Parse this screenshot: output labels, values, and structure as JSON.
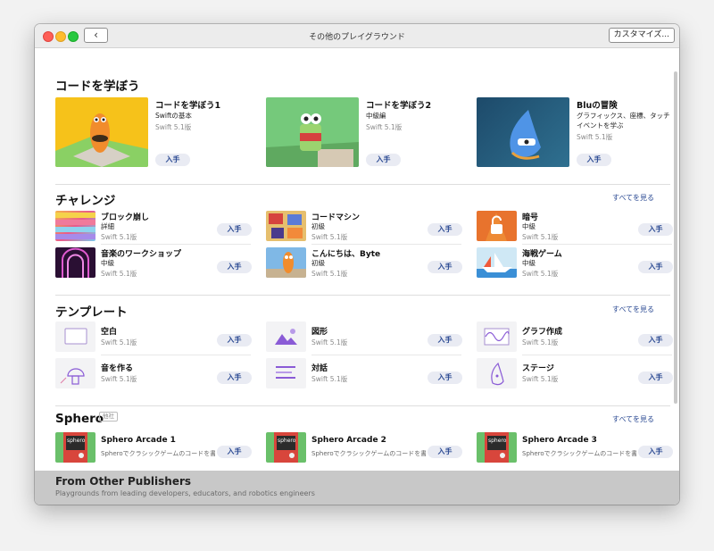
{
  "window": {
    "title": "その他のプレイグラウンド",
    "back_label": "‹",
    "customize_label": "カスタマイズ..."
  },
  "sections": {
    "learn": {
      "title": "コードを学ぼう",
      "items": [
        {
          "title": "コードを学ぼう1",
          "subtitle": "Swiftの基本",
          "version": "Swift 5.1版",
          "button": "入手"
        },
        {
          "title": "コードを学ぼう2",
          "subtitle": "中級編",
          "version": "Swift 5.1版",
          "button": "入手"
        },
        {
          "title": "Bluの冒険",
          "subtitle": "グラフィックス、座標、タッチ",
          "subtitle2": "イベントを学ぶ",
          "version": "Swift 5.1版",
          "button": "入手"
        }
      ]
    },
    "challenge": {
      "title": "チャレンジ",
      "see_all": "すべてを見る",
      "items": [
        {
          "title": "ブロック崩し",
          "level": "詳細",
          "version": "Swift 5.1版",
          "button": "入手"
        },
        {
          "title": "コードマシン",
          "level": "初級",
          "version": "Swift 5.1版",
          "button": "入手"
        },
        {
          "title": "暗号",
          "level": "中級",
          "version": "Swift 5.1版",
          "button": "入手"
        },
        {
          "title": "音楽のワークショップ",
          "level": "中級",
          "version": "Swift 5.1版",
          "button": "入手"
        },
        {
          "title": "こんにちは、Byte",
          "level": "初級",
          "version": "Swift 5.1版",
          "button": "入手"
        },
        {
          "title": "海戦ゲーム",
          "level": "中級",
          "version": "Swift 5.1版",
          "button": "入手"
        }
      ]
    },
    "template": {
      "title": "テンプレート",
      "see_all": "すべてを見る",
      "items": [
        {
          "title": "空白",
          "version": "Swift 5.1版",
          "button": "入手"
        },
        {
          "title": "図形",
          "version": "Swift 5.1版",
          "button": "入手"
        },
        {
          "title": "グラフ作成",
          "version": "Swift 5.1版",
          "button": "入手"
        },
        {
          "title": "音を作る",
          "version": "Swift 5.1版",
          "button": "入手"
        },
        {
          "title": "対話",
          "version": "Swift 5.1版",
          "button": "入手"
        },
        {
          "title": "ステージ",
          "version": "Swift 5.1版",
          "button": "入手"
        }
      ]
    },
    "sphero": {
      "title": "Sphero",
      "badge": "他社",
      "see_all": "すべてを見る",
      "items": [
        {
          "title": "Sphero Arcade 1",
          "desc": "Spheroでクラシックゲームのコードを書…",
          "button": "入手",
          "logo": "sphero"
        },
        {
          "title": "Sphero Arcade 2",
          "desc": "Spheroでクラシックゲームのコードを書…",
          "button": "入手",
          "logo": "sphero"
        },
        {
          "title": "Sphero Arcade 3",
          "desc": "Spheroでクラシックゲームのコードを書…",
          "button": "入手",
          "logo": "sphero"
        }
      ]
    }
  },
  "footer": {
    "title": "From Other Publishers",
    "subtitle": "Playgrounds from leading developers, educators, and robotics engineers"
  }
}
